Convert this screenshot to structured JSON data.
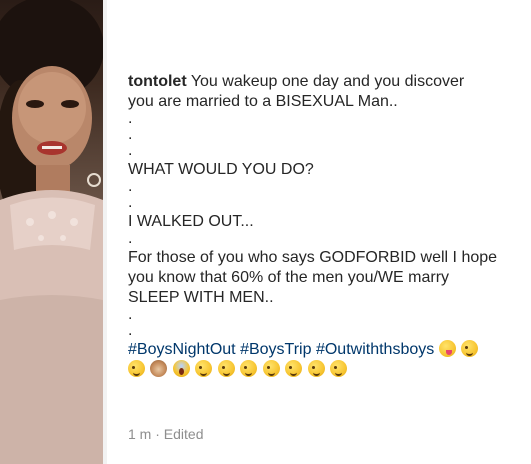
{
  "post": {
    "username": "tontolet",
    "caption_line1": "You wakeup one day and you discover",
    "caption_line2": "you are married to a BISEXUAL Man..",
    "dot": ".",
    "question": "WHAT WOULD YOU DO?",
    "answer": "I WALKED OUT...",
    "para_line1": "For those of you who says GODFORBID well I hope",
    "para_line2": "you know that 60% of the men you/WE marry",
    "para_line3": "SLEEP WITH MEN..",
    "hashtags": [
      "#BoysNightOut",
      "#BoysTrip",
      "#Outwiththsboys"
    ],
    "emojis_row1": [
      "face-with-tongue-emoji",
      "smiling-face-emoji"
    ],
    "emojis_row2": [
      "winking-tongue-emoji",
      "see-no-evil-monkey-emoji",
      "screaming-face-emoji",
      "winking-tongue-emoji",
      "winking-tongue-emoji",
      "winking-tongue-emoji",
      "winking-tongue-emoji",
      "winking-tongue-emoji",
      "winking-tongue-emoji",
      "winking-tongue-emoji"
    ],
    "timestamp": "1 m",
    "edited": "Edited",
    "separator": "·"
  }
}
